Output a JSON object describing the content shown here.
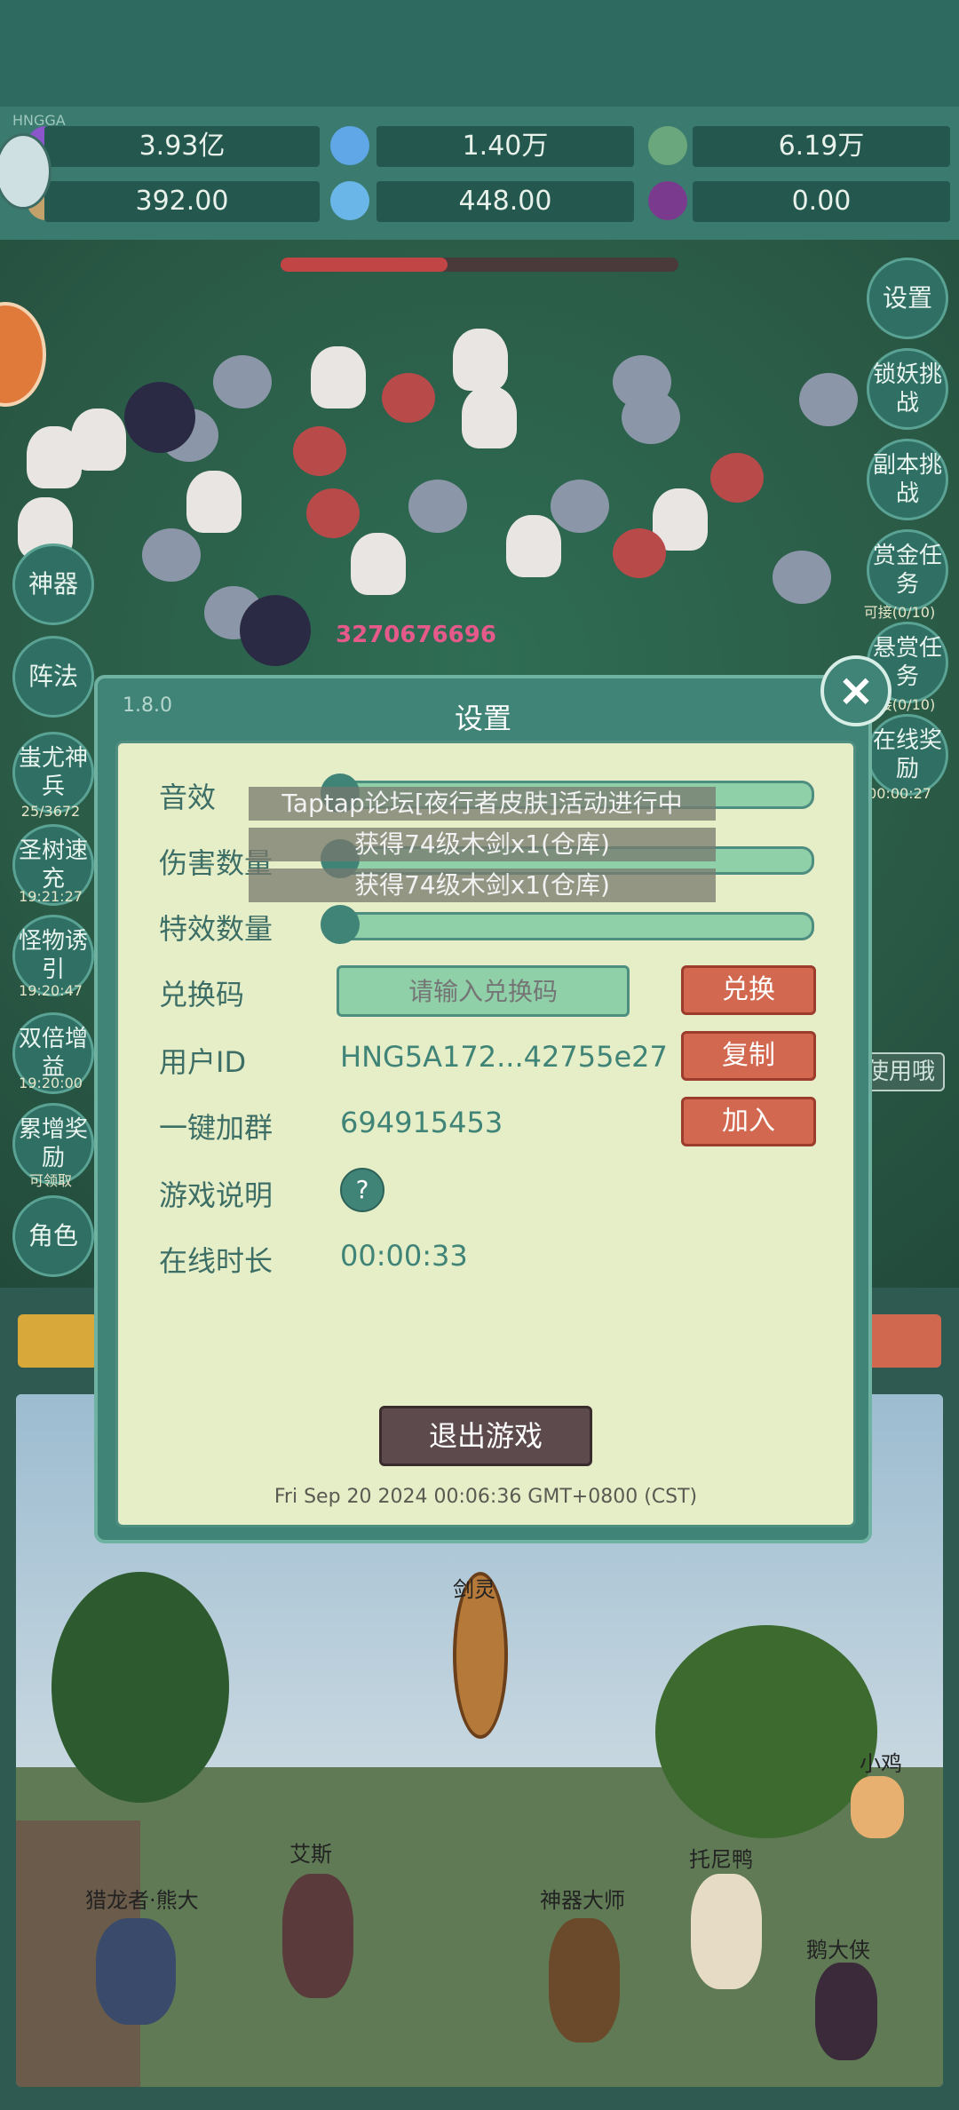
{
  "header": {
    "tag": "HNGGA"
  },
  "resources": [
    {
      "value": "3.93亿",
      "icon": "purple-gem-icon"
    },
    {
      "value": "1.40万",
      "icon": "blue-crystal-icon"
    },
    {
      "value": "6.19万",
      "icon": "green-orb-icon"
    },
    {
      "value": "392.00",
      "icon": "scroll-icon"
    },
    {
      "value": "448.00",
      "icon": "ice-crystal-icon"
    },
    {
      "value": "0.00",
      "icon": "purple-fruit-icon"
    }
  ],
  "right_menu": [
    {
      "label": "设置",
      "sub": ""
    },
    {
      "label": "锁妖挑战",
      "sub": ""
    },
    {
      "label": "副本挑战",
      "sub": ""
    },
    {
      "label": "赏金任务",
      "sub": "可接(0/10)"
    },
    {
      "label": "悬赏任务",
      "sub": "可接(0/10)"
    },
    {
      "label": "在线奖励",
      "sub": "00:00:27"
    }
  ],
  "left_menu": [
    {
      "label": "神器",
      "sub": ""
    },
    {
      "label": "阵法",
      "sub": ""
    },
    {
      "label": "蚩尤神兵",
      "sub": "25/3672"
    },
    {
      "label": "圣树速充",
      "sub": "19:21:27"
    },
    {
      "label": "怪物诱引",
      "sub": "19:20:47"
    },
    {
      "label": "双倍增益",
      "sub": "19:20:00"
    },
    {
      "label": "累增奖励",
      "sub": "可领取"
    },
    {
      "label": "角色",
      "sub": ""
    }
  ],
  "damage_number": "3270676696",
  "right_partial_button": "使用哦",
  "dialog": {
    "version": "1.8.0",
    "title": "设置",
    "close_icon": "close-icon",
    "rows": {
      "sound_label": "音效",
      "damage_count_label": "伤害数量",
      "effect_count_label": "特效数量",
      "redeem_label": "兑换码",
      "redeem_placeholder": "请输入兑换码",
      "redeem_button": "兑换",
      "user_id_label": "用户ID",
      "user_id_value": "HNG5A172...42755e27",
      "copy_button": "复制",
      "group_label": "一键加群",
      "group_value": "694915453",
      "join_button": "加入",
      "help_label": "游戏说明",
      "help_icon": "?",
      "online_label": "在线时长",
      "online_value": "00:00:33"
    },
    "sliders": {
      "sound": 0.0,
      "damage_count": 0.0,
      "effect_count": 0.0
    },
    "exit_button": "退出游戏",
    "timestamp": "Fri Sep 20 2024 00:06:36 GMT+0800 (CST)"
  },
  "toasts": [
    "Taptap论坛[夜行者皮肤]活动进行中",
    "获得74级木剑x1(仓库)",
    "获得74级木剑x1(仓库)"
  ],
  "scene_characters": [
    "剑灵",
    "小鸡",
    "艾斯",
    "托尼鸭",
    "猎龙者·熊大",
    "神器大师",
    "鹅大侠"
  ],
  "colors": {
    "accent": "#3f8477",
    "button_red": "#d2684f",
    "panel_bg": "#e6eec7"
  }
}
